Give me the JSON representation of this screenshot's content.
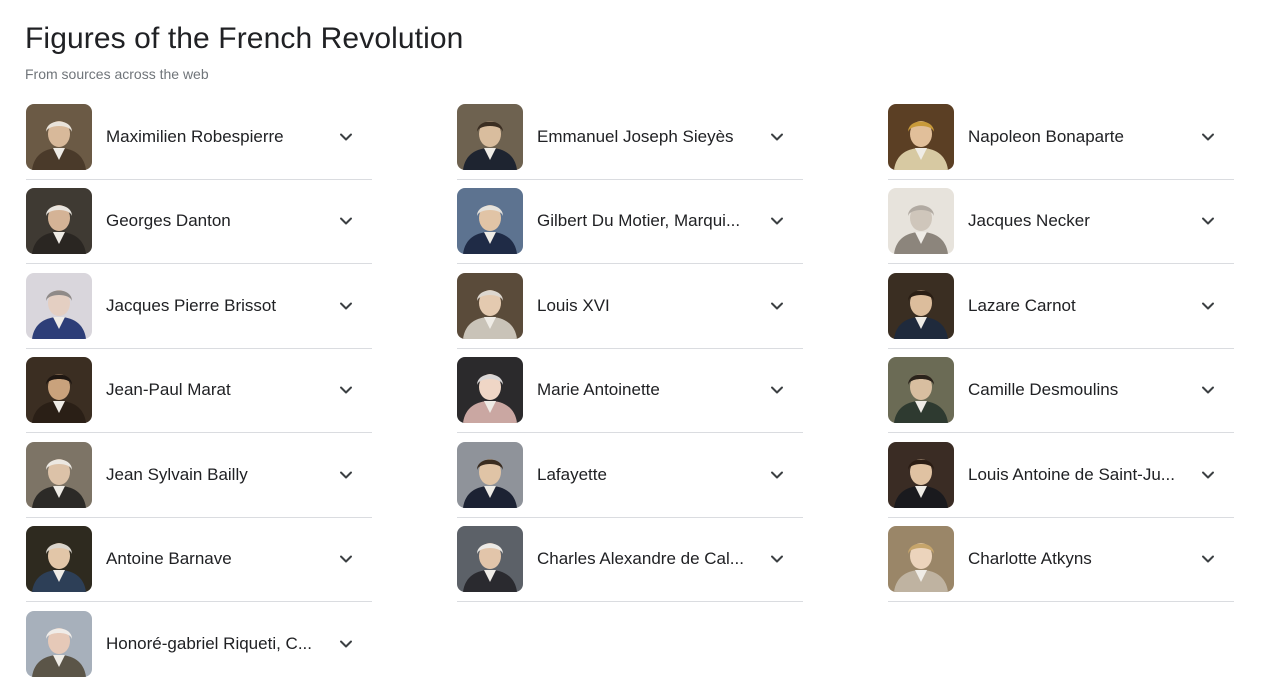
{
  "header": {
    "title": "Figures of the French Revolution",
    "subtitle": "From sources across the web"
  },
  "icons": {
    "expand": "chevron-down-icon"
  },
  "columns": [
    [
      {
        "name": "Maximilien Robespierre",
        "bg": "#6b5a45",
        "face": "#d8b99a",
        "hair": "#e9e3da",
        "coat": "#4a3a2a"
      },
      {
        "name": "Georges Danton",
        "bg": "#3f3a33",
        "face": "#d4b396",
        "hair": "#e8e4de",
        "coat": "#2a2622"
      },
      {
        "name": "Jacques Pierre Brissot",
        "bg": "#d9d6dc",
        "face": "#e4cfc2",
        "hair": "#8f8a88",
        "coat": "#2d3e78"
      },
      {
        "name": "Jean-Paul Marat",
        "bg": "#3b2e22",
        "face": "#c9a27c",
        "hair": "#1f1712",
        "coat": "#2a1f16"
      },
      {
        "name": "Jean Sylvain Bailly",
        "bg": "#7d7466",
        "face": "#dcc2a8",
        "hair": "#ece8e2",
        "coat": "#2c2a27"
      },
      {
        "name": "Antoine Barnave",
        "bg": "#2e2a1f",
        "face": "#e2c6a8",
        "hair": "#d9d4cc",
        "coat": "#2d3f57"
      },
      {
        "name": "Honoré-gabriel Riqueti, C...",
        "bg": "#a7b0bb",
        "face": "#e6c9b8",
        "hair": "#f0ece8",
        "coat": "#5b5548"
      }
    ],
    [
      {
        "name": "Emmanuel Joseph Sieyès",
        "bg": "#6e6250",
        "face": "#d9bd9e",
        "hair": "#3b2e22",
        "coat": "#1e2430"
      },
      {
        "name": "Gilbert Du Motier, Marqui...",
        "bg": "#5d7390",
        "face": "#e1c4a6",
        "hair": "#e5e2dc",
        "coat": "#1f2b46"
      },
      {
        "name": "Louis XVI",
        "bg": "#5a4b3a",
        "face": "#e4cab0",
        "hair": "#ddd7cf",
        "coat": "#c9c3b8"
      },
      {
        "name": "Marie Antoinette",
        "bg": "#2b2a2c",
        "face": "#efd6c6",
        "hair": "#d9d6d6",
        "coat": "#caa7a2"
      },
      {
        "name": "Lafayette",
        "bg": "#8f939a",
        "face": "#e0c4a6",
        "hair": "#3a2c20",
        "coat": "#1c2233"
      },
      {
        "name": "Charles Alexandre de Cal...",
        "bg": "#5c6168",
        "face": "#e2c5aa",
        "hair": "#eceae6",
        "coat": "#2a2a2f"
      }
    ],
    [
      {
        "name": "Napoleon Bonaparte",
        "bg": "#5b3f24",
        "face": "#e1bf9a",
        "hair": "#c89a3a",
        "coat": "#d7c9a2"
      },
      {
        "name": "Jacques Necker",
        "bg": "#e7e3dc",
        "face": "#cfc6bb",
        "hair": "#b1aaa2",
        "coat": "#8c857c"
      },
      {
        "name": "Lazare Carnot",
        "bg": "#3a2e22",
        "face": "#dcbd9c",
        "hair": "#2a1e14",
        "coat": "#1f2a3c"
      },
      {
        "name": "Camille Desmoulins",
        "bg": "#6b6b55",
        "face": "#d8bea0",
        "hair": "#2b231b",
        "coat": "#2e3a30"
      },
      {
        "name": "Louis Antoine de Saint-Ju...",
        "bg": "#3a2c24",
        "face": "#e0c2a2",
        "hair": "#2b1d14",
        "coat": "#1a1a1e"
      },
      {
        "name": "Charlotte Atkyns",
        "bg": "#9a8668",
        "face": "#ecd4bc",
        "hair": "#c6a56b",
        "coat": "#bfb3a1"
      }
    ]
  ]
}
